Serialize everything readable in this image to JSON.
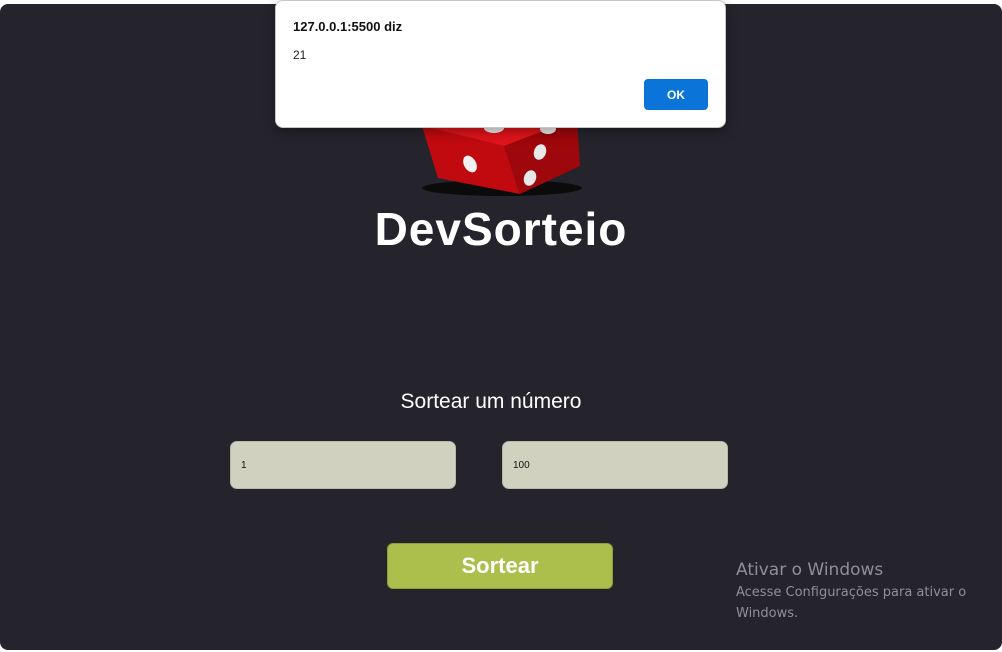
{
  "app": {
    "brand_name": "DevSorteio",
    "subtitle": "Sortear um número",
    "min_input_value": "1",
    "max_input_value": "100",
    "draw_button_label": "Sortear",
    "colors": {
      "background": "#25242d",
      "input_bg": "#d0d2bf",
      "button_bg": "#acbf4c",
      "dice_red": "#d40d12"
    }
  },
  "dialog": {
    "title": "127.0.0.1:5500 diz",
    "message": "21",
    "ok_label": "OK",
    "ok_color": "#0a74d9"
  },
  "watermark": {
    "title": "Ativar o Windows",
    "text": "Acesse Configurações para ativar o Windows."
  }
}
